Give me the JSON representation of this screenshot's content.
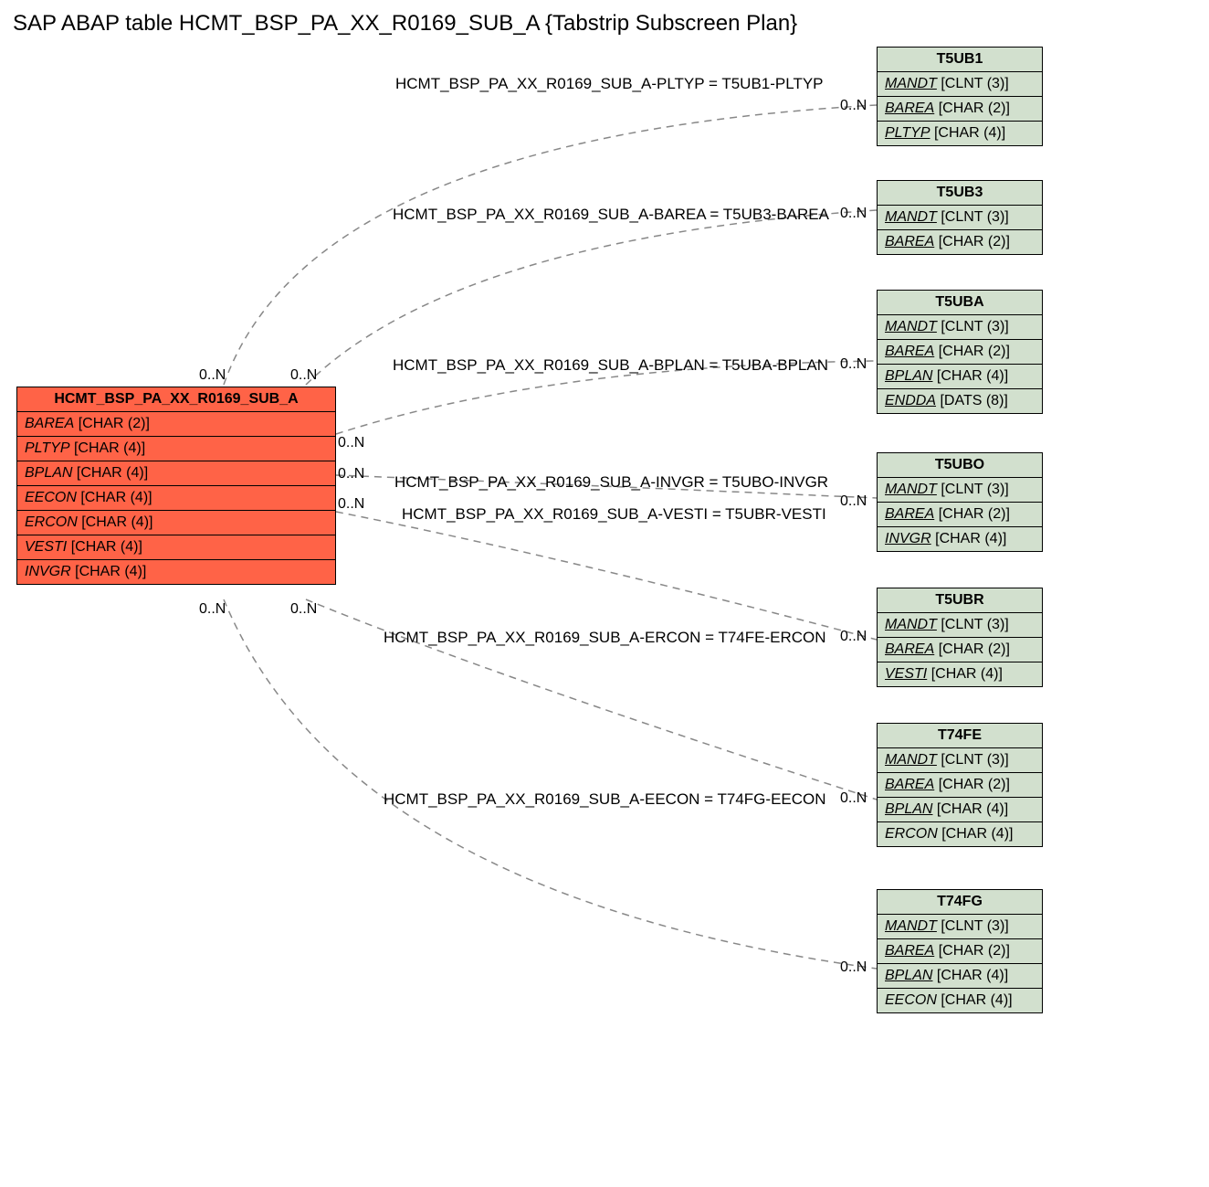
{
  "title": "SAP ABAP table HCMT_BSP_PA_XX_R0169_SUB_A {Tabstrip Subscreen Plan}",
  "main": {
    "name": "HCMT_BSP_PA_XX_R0169_SUB_A",
    "fields": [
      {
        "name": "BAREA",
        "type": "[CHAR (2)]"
      },
      {
        "name": "PLTYP",
        "type": "[CHAR (4)]"
      },
      {
        "name": "BPLAN",
        "type": "[CHAR (4)]"
      },
      {
        "name": "EECON",
        "type": "[CHAR (4)]"
      },
      {
        "name": "ERCON",
        "type": "[CHAR (4)]"
      },
      {
        "name": "VESTI",
        "type": "[CHAR (4)]"
      },
      {
        "name": "INVGR",
        "type": "[CHAR (4)]"
      }
    ]
  },
  "refs": [
    {
      "name": "T5UB1",
      "fields": [
        {
          "name": "MANDT",
          "type": "[CLNT (3)]",
          "key": true
        },
        {
          "name": "BAREA",
          "type": "[CHAR (2)]",
          "key": true
        },
        {
          "name": "PLTYP",
          "type": "[CHAR (4)]",
          "key": true
        }
      ]
    },
    {
      "name": "T5UB3",
      "fields": [
        {
          "name": "MANDT",
          "type": "[CLNT (3)]",
          "key": true
        },
        {
          "name": "BAREA",
          "type": "[CHAR (2)]",
          "key": true
        }
      ]
    },
    {
      "name": "T5UBA",
      "fields": [
        {
          "name": "MANDT",
          "type": "[CLNT (3)]",
          "key": true
        },
        {
          "name": "BAREA",
          "type": "[CHAR (2)]",
          "key": true
        },
        {
          "name": "BPLAN",
          "type": "[CHAR (4)]",
          "key": true
        },
        {
          "name": "ENDDA",
          "type": "[DATS (8)]",
          "key": true
        }
      ]
    },
    {
      "name": "T5UBO",
      "fields": [
        {
          "name": "MANDT",
          "type": "[CLNT (3)]",
          "key": true
        },
        {
          "name": "BAREA",
          "type": "[CHAR (2)]",
          "key": true
        },
        {
          "name": "INVGR",
          "type": "[CHAR (4)]",
          "key": true
        }
      ]
    },
    {
      "name": "T5UBR",
      "fields": [
        {
          "name": "MANDT",
          "type": "[CLNT (3)]",
          "key": true
        },
        {
          "name": "BAREA",
          "type": "[CHAR (2)]",
          "key": true
        },
        {
          "name": "VESTI",
          "type": "[CHAR (4)]",
          "key": true
        }
      ]
    },
    {
      "name": "T74FE",
      "fields": [
        {
          "name": "MANDT",
          "type": "[CLNT (3)]",
          "key": true
        },
        {
          "name": "BAREA",
          "type": "[CHAR (2)]",
          "key": true
        },
        {
          "name": "BPLAN",
          "type": "[CHAR (4)]",
          "key": true
        },
        {
          "name": "ERCON",
          "type": "[CHAR (4)]"
        }
      ]
    },
    {
      "name": "T74FG",
      "fields": [
        {
          "name": "MANDT",
          "type": "[CLNT (3)]",
          "key": true
        },
        {
          "name": "BAREA",
          "type": "[CHAR (2)]",
          "key": true
        },
        {
          "name": "BPLAN",
          "type": "[CHAR (4)]",
          "key": true
        },
        {
          "name": "EECON",
          "type": "[CHAR (4)]"
        }
      ]
    }
  ],
  "relations": [
    {
      "label": "HCMT_BSP_PA_XX_R0169_SUB_A-PLTYP = T5UB1-PLTYP"
    },
    {
      "label": "HCMT_BSP_PA_XX_R0169_SUB_A-BAREA = T5UB3-BAREA"
    },
    {
      "label": "HCMT_BSP_PA_XX_R0169_SUB_A-BPLAN = T5UBA-BPLAN"
    },
    {
      "label": "HCMT_BSP_PA_XX_R0169_SUB_A-INVGR = T5UBO-INVGR"
    },
    {
      "label": "HCMT_BSP_PA_XX_R0169_SUB_A-VESTI = T5UBR-VESTI"
    },
    {
      "label": "HCMT_BSP_PA_XX_R0169_SUB_A-ERCON = T74FE-ERCON"
    },
    {
      "label": "HCMT_BSP_PA_XX_R0169_SUB_A-EECON = T74FG-EECON"
    }
  ],
  "card": "0..N"
}
